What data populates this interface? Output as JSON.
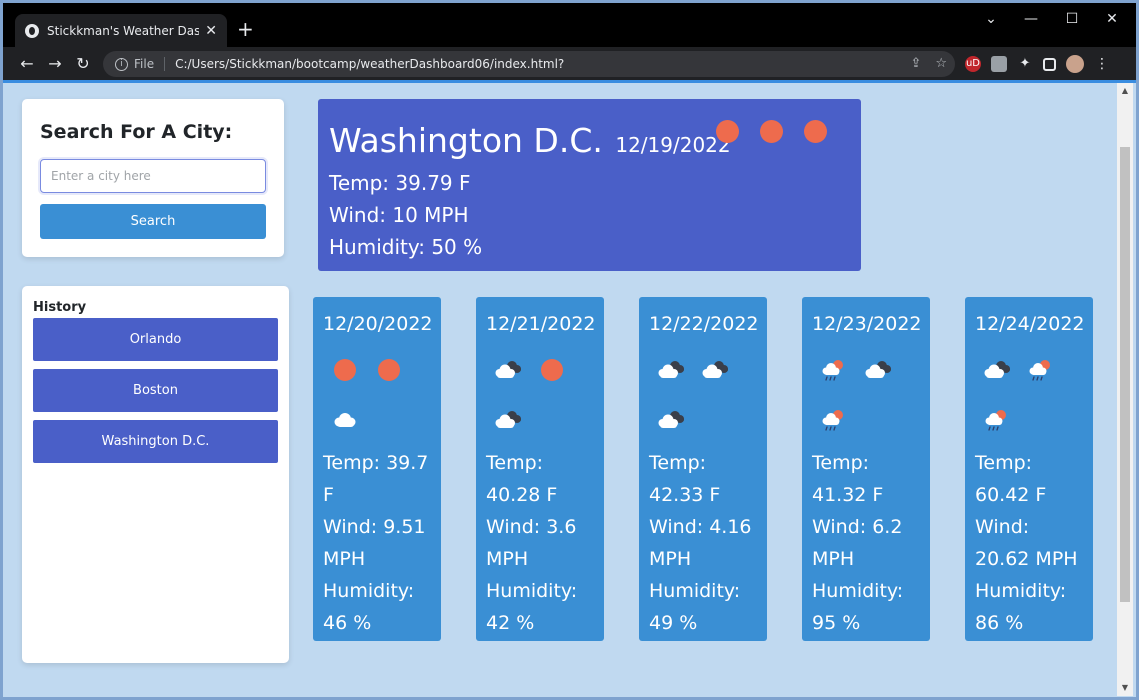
{
  "browser": {
    "tab_title": "Stickkman's Weather Dashboard",
    "tab_close": "✕",
    "new_tab": "+",
    "protocol_label": "File",
    "url": "C:/Users/Stickkman/bootcamp/weatherDashboard06/index.html?",
    "controls": {
      "back": "←",
      "forward": "→",
      "reload": "↻",
      "chevron": "⌄",
      "minimize": "—",
      "maximize": "☐",
      "close": "✕"
    },
    "ext_ud": "uD"
  },
  "search": {
    "heading": "Search For A City:",
    "placeholder": "Enter a city here",
    "button": "Search"
  },
  "history": {
    "heading": "History",
    "items": [
      "Orlando",
      "Boston",
      "Washington D.C."
    ]
  },
  "current": {
    "city": "Washington D.C.",
    "date": "12/19/2022",
    "icons": [
      "sun",
      "sun",
      "sun"
    ],
    "temp": "Temp: 39.79 F",
    "wind": "Wind: 10 MPH",
    "humidity": "Humidity: 50 %"
  },
  "forecast": [
    {
      "date": "12/20/2022",
      "icons": [
        "sun",
        "sun",
        "cloud"
      ],
      "temp": "Temp: 39.7 F",
      "wind": "Wind: 9.51 MPH",
      "humidity": "Humidity: 46 %"
    },
    {
      "date": "12/21/2022",
      "icons": [
        "cloud-dark",
        "sun",
        "cloud-dark"
      ],
      "temp": "Temp: 40.28 F",
      "wind": "Wind: 3.6 MPH",
      "humidity": "Humidity: 42 %"
    },
    {
      "date": "12/22/2022",
      "icons": [
        "cloud-dark",
        "cloud-dark",
        "cloud-dark"
      ],
      "temp": "Temp: 42.33 F",
      "wind": "Wind: 4.16 MPH",
      "humidity": "Humidity: 49 %"
    },
    {
      "date": "12/23/2022",
      "icons": [
        "rain-sun",
        "cloud-dark",
        "rain-sun"
      ],
      "temp": "Temp: 41.32 F",
      "wind": "Wind: 6.2 MPH",
      "humidity": "Humidity: 95 %"
    },
    {
      "date": "12/24/2022",
      "icons": [
        "cloud-dark",
        "rain-sun",
        "rain-sun"
      ],
      "temp": "Temp: 60.42 F",
      "wind": "Wind: 20.62 MPH",
      "humidity": "Humidity: 86 %"
    }
  ],
  "colors": {
    "current_card": "#4a5fc8",
    "forecast_card": "#3a8fd4",
    "history_button": "#4a5fc8",
    "search_button": "#3a8fd4",
    "sun": "#ee6b4d",
    "page_background": "#c0d9f0"
  }
}
